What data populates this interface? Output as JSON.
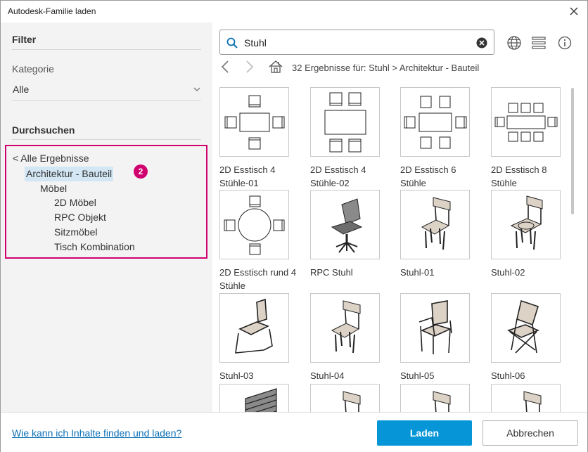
{
  "window": {
    "title": "Autodesk-Familie laden"
  },
  "filter": {
    "heading": "Filter",
    "category_label": "Kategorie",
    "category_value": "Alle"
  },
  "browse": {
    "heading": "Durchsuchen",
    "tree": {
      "back": "< Alle Ergebnisse",
      "selected": "Architektur - Bauteil",
      "badge": "2",
      "sub": "Möbel",
      "children": [
        "2D Möbel",
        "RPC Objekt",
        "Sitzmöbel",
        "Tisch Kombination"
      ]
    }
  },
  "search": {
    "value": "Stuhl"
  },
  "results_text": "32 Ergebnisse für: Stuhl > Architektur - Bauteil",
  "items": [
    {
      "label": "2D Esstisch 4 Stühle-01",
      "icon": "plan-table-4-chairs"
    },
    {
      "label": "2D Esstisch 4 Stühle-02",
      "icon": "plan-table-4-chairs-long"
    },
    {
      "label": "2D Esstisch 6 Stühle",
      "icon": "plan-table-6-chairs"
    },
    {
      "label": "2D Esstisch 8 Stühle",
      "icon": "plan-table-8-chairs"
    },
    {
      "label": "2D Esstisch rund 4 Stühle",
      "icon": "plan-round-table-4-chairs"
    },
    {
      "label": "RPC Stuhl",
      "icon": "office-chair"
    },
    {
      "label": "Stuhl-01",
      "icon": "chair"
    },
    {
      "label": "Stuhl-02",
      "icon": "chair-round-seat"
    },
    {
      "label": "Stuhl-03",
      "icon": "sled-chair"
    },
    {
      "label": "Stuhl-04",
      "icon": "chair"
    },
    {
      "label": "Stuhl-05",
      "icon": "armchair"
    },
    {
      "label": "Stuhl-06",
      "icon": "folding-chair"
    },
    {
      "label": "",
      "icon": "bench"
    },
    {
      "label": "",
      "icon": "chair"
    },
    {
      "label": "",
      "icon": "chair"
    },
    {
      "label": "",
      "icon": "chair"
    }
  ],
  "footer": {
    "help_link": "Wie kann ich Inhalte finden und laden?",
    "load_button": "Laden",
    "cancel_button": "Abbrechen"
  },
  "colors": {
    "accent": "#0696d7",
    "highlight": "#d0006f",
    "selection": "#d2e6f4"
  }
}
